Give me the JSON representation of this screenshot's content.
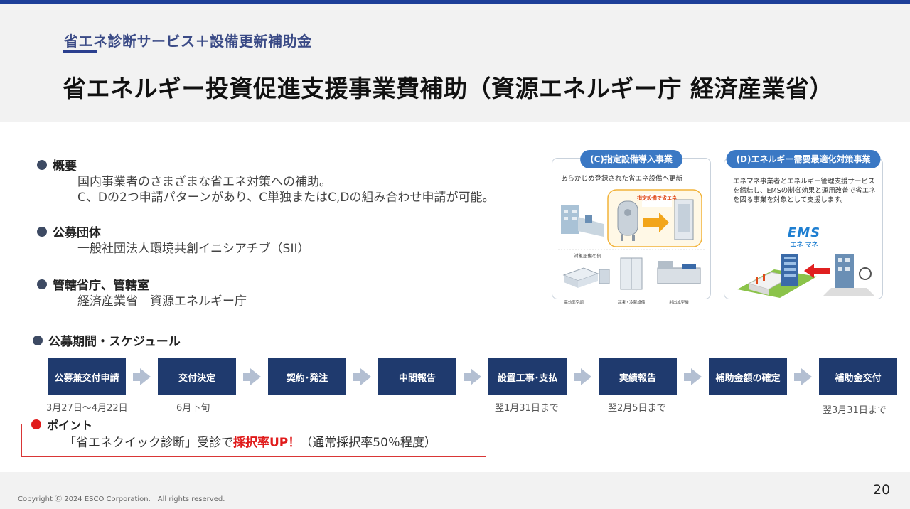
{
  "header": {
    "subtitle": "省エネ診断サービス＋設備更新補助金",
    "title": "省エネルギー投資促進支援事業費補助（資源エネルギー庁 経済産業省）"
  },
  "sections": {
    "overview": {
      "heading": "概要",
      "lines": [
        "国内事業者のさまざまな省エネ対策への補助。",
        "C、Dの2つ申請パターンがあり、C単独またはC,Dの組み合わせ申請が可能。"
      ]
    },
    "org": {
      "heading": "公募団体",
      "lines": [
        "一般社団法人環境共創イニシアチブ（SII）"
      ]
    },
    "ministry": {
      "heading": "管轄省庁、管轄室",
      "lines": [
        "経済産業省　資源エネルギー庁"
      ]
    },
    "schedule": {
      "heading": "公募期間・スケジュール"
    }
  },
  "cards": {
    "c": {
      "title": "(C)指定設備導入事業",
      "text": "あらかじめ登録された省エネ設備へ更新",
      "badge": "指定設備で省エネ",
      "examples_label": "対象設備の例",
      "examples": [
        "高効率空調",
        "冷凍・冷蔵設備",
        "射出成型機"
      ]
    },
    "d": {
      "title": "(D)エネルギー需要最適化対策事業",
      "text": "エネマネ事業者とエネルギー管理支援サービスを締結し、EMSの制御効果と運用改善で省エネを図る事業を対象として支援します。",
      "logo": "EMS",
      "logo_sub": "エネ マネ"
    }
  },
  "steps": [
    {
      "label": "公募兼交付申請",
      "date": "3月27日～4月22日"
    },
    {
      "label": "交付決定",
      "date": "6月下旬"
    },
    {
      "label": "契約･発注",
      "date": ""
    },
    {
      "label": "中間報告",
      "date": ""
    },
    {
      "label": "設置工事･支払",
      "date": "翌1月31日まで"
    },
    {
      "label": "実績報告",
      "date": "翌2月5日まで"
    },
    {
      "label": "補助金額の確定",
      "date": ""
    },
    {
      "label": "補助金交付",
      "date": "翌3月31日まで"
    }
  ],
  "point": {
    "label": "ポイント",
    "text_before": "「省エネクイック診断」受診で",
    "emphasis": "採択率UP！",
    "text_after": "（通常採択率50％程度）"
  },
  "footer": {
    "copyright": "Copyright Ⓒ 2024 ESCO Corporation.　All rights reserved.",
    "page_number": "20"
  },
  "colors": {
    "accent": "#1e3f99",
    "step": "#1f3a6e",
    "emphasis": "#e01b1b",
    "card_title": "#3a78c4"
  }
}
